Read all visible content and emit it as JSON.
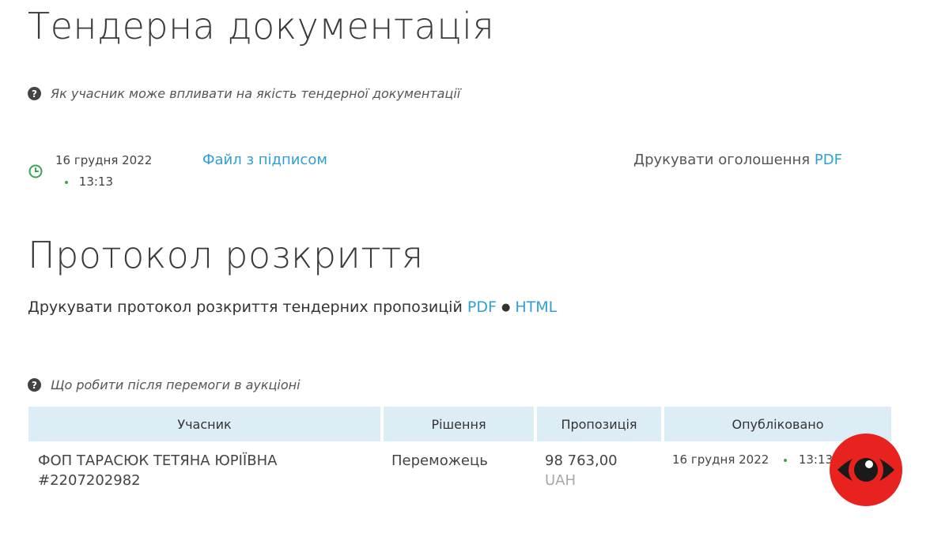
{
  "tender_docs": {
    "title": "Тендерна документація",
    "help_text": "Як учасник може впливати на якість тендерної документації",
    "date": "16 грудня 2022",
    "time": "13:13",
    "signed_file_link": "Файл з підписом",
    "print_label": "Друкувати оголошення",
    "print_pdf": "PDF"
  },
  "protocol": {
    "title": "Протокол розкриття",
    "print_label": "Друкувати протокол розкриття тендерних пропозицій",
    "pdf": "PDF",
    "separator": "●",
    "html": "HTML"
  },
  "auction": {
    "help_text": "Що робити після перемоги в аукціоні"
  },
  "table": {
    "headers": [
      "Учасник",
      "Рішення",
      "Пропозиція",
      "Опубліковано"
    ],
    "rows": [
      {
        "participant": "ФОП ТАРАСЮК ТЕТЯНА ЮРІЇВНА",
        "participant_id": "#2207202982",
        "decision": "Переможець",
        "amount": "98 763,00",
        "currency": "UAH",
        "published_date": "16 грудня 2022",
        "published_time": "13:13"
      }
    ]
  },
  "colors": {
    "link": "#2e9fd8",
    "header_bg": "#dcedf5",
    "status_green": "#3aa655",
    "logo_red": "#e8231f"
  },
  "icons": {
    "help": "question-circle-icon",
    "clock": "clock-icon",
    "logo": "eye-logo-icon"
  }
}
